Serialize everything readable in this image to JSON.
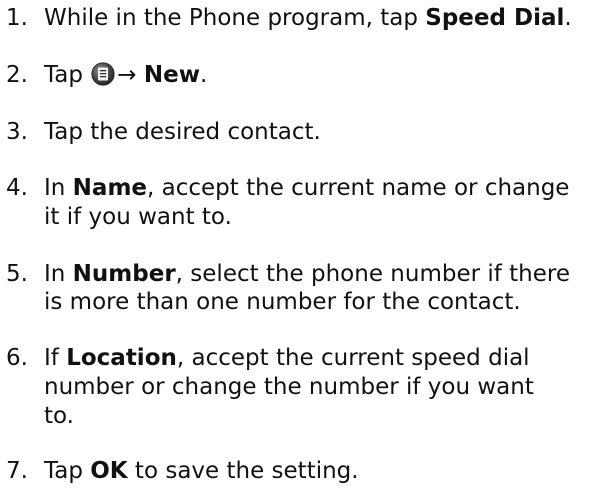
{
  "steps": [
    {
      "number": "1.",
      "before": "While in the Phone program, tap ",
      "bold": "Speed Dial",
      "after": "."
    },
    {
      "number": "2.",
      "before": "Tap ",
      "icon": "menu-icon",
      "arrow": "→",
      "bold": "New",
      "after": "."
    },
    {
      "number": "3.",
      "text": "Tap the desired contact."
    },
    {
      "number": "4.",
      "before": "In ",
      "bold": "Name",
      "after_line1": ", accept the current name or change",
      "line2": "it if you want to."
    },
    {
      "number": "5.",
      "before": "In ",
      "bold": "Number",
      "after_line1": ", select the phone number if there",
      "line2": "is more than one number for the contact."
    },
    {
      "number": "6.",
      "before": "If ",
      "bold": "Location",
      "after_line1": ", accept the current speed dial",
      "line2": "number or change the number if you want",
      "line3": "to."
    },
    {
      "number": "7.",
      "before": "Tap ",
      "bold": "OK",
      "after": " to save the setting."
    }
  ]
}
